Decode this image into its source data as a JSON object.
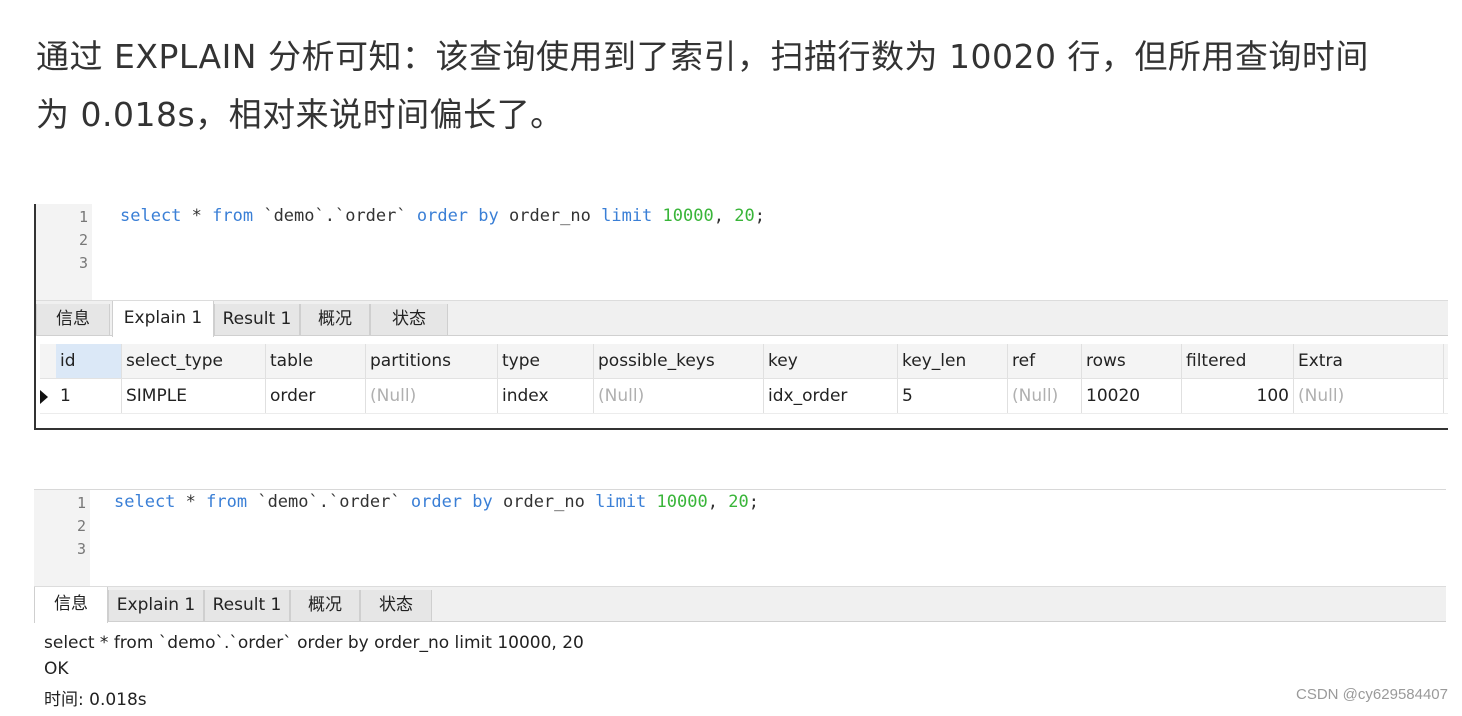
{
  "article": {
    "line1": "通过 EXPLAIN 分析可知：该查询使用到了索引，扫描行数为 10020 行，但所用查询时间",
    "line2": "为 0.018s，相对来说时间偏长了。"
  },
  "editor1": {
    "line_numbers": [
      "1",
      "2",
      "3"
    ],
    "sql": {
      "kw_select": "select",
      "star": " * ",
      "kw_from": "from",
      "table": " `demo`.`order` ",
      "kw_order_by": "order by",
      "col": " order_no ",
      "kw_limit": "limit",
      "sp": " ",
      "offset": "10000",
      "comma": ", ",
      "count": "20",
      "semi": ";"
    }
  },
  "tabs1": [
    "信息",
    "Explain 1",
    "Result 1",
    "概况",
    "状态"
  ],
  "explain": {
    "columns": [
      "id",
      "select_type",
      "table",
      "partitions",
      "type",
      "possible_keys",
      "key",
      "key_len",
      "ref",
      "rows",
      "filtered",
      "Extra"
    ],
    "row": [
      "1",
      "SIMPLE",
      "order",
      "(Null)",
      "index",
      "(Null)",
      "idx_order",
      "5",
      "(Null)",
      "10020",
      "100",
      "(Null)"
    ]
  },
  "editor2": {
    "line_numbers": [
      "1",
      "2",
      "3"
    ],
    "sql": {
      "kw_select": "select",
      "star": " * ",
      "kw_from": "from",
      "table": " `demo`.`order` ",
      "kw_order_by": "order by",
      "col": " order_no ",
      "kw_limit": "limit",
      "sp": " ",
      "offset": "10000",
      "comma": ", ",
      "count": "20",
      "semi": ";"
    }
  },
  "tabs2": [
    "信息",
    "Explain 1",
    "Result 1",
    "概况",
    "状态"
  ],
  "messages": {
    "query": "select * from `demo`.`order` order by order_no limit 10000, 20",
    "status": "OK",
    "time": "时间: 0.018s"
  },
  "watermark": "CSDN @cy629584407",
  "colors": {
    "keyword": "#3a7fd6",
    "number": "#39b539",
    "null_text": "#b0b0b0",
    "selected_id": "#dbe8f7"
  }
}
